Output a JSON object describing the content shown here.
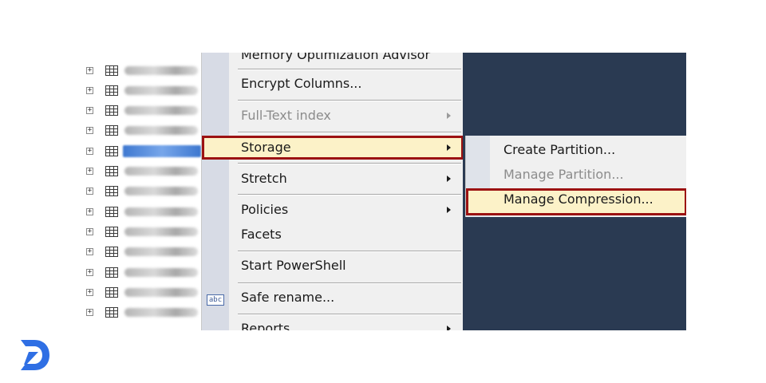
{
  "menu": {
    "items": [
      {
        "label": "Memory Optimization Advisor",
        "enabled": true,
        "submenu": false
      },
      {
        "label": "Encrypt Columns...",
        "enabled": true,
        "submenu": false
      },
      {
        "label": "Full-Text index",
        "enabled": false,
        "submenu": true
      },
      {
        "label": "Storage",
        "enabled": true,
        "submenu": true,
        "highlighted": true
      },
      {
        "label": "Stretch",
        "enabled": true,
        "submenu": true
      },
      {
        "label": "Policies",
        "enabled": true,
        "submenu": true
      },
      {
        "label": "Facets",
        "enabled": true,
        "submenu": false
      },
      {
        "label": "Start PowerShell",
        "enabled": true,
        "submenu": false
      },
      {
        "label": "Safe rename...",
        "enabled": true,
        "submenu": false
      },
      {
        "label": "Reports",
        "enabled": true,
        "submenu": true
      }
    ],
    "rename_icon_text": "abc"
  },
  "submenu": {
    "items": [
      {
        "label": "Create Partition...",
        "enabled": true
      },
      {
        "label": "Manage Partition...",
        "enabled": false
      },
      {
        "label": "Manage Compression...",
        "enabled": true,
        "highlighted": true
      }
    ]
  },
  "tree": {
    "expander_glyph": "+",
    "row_count": 13,
    "selected_row": 4
  },
  "colors": {
    "highlight_border": "#9c1212",
    "highlight_fill": "#fcf2c8",
    "background_dark": "#2a3a52",
    "logo_blue": "#2f6fe4"
  },
  "icons": {
    "tree_expander": "plus-box-icon",
    "tree_table": "table-grid-icon",
    "submenu_arrow": "chevron-right-icon",
    "rename": "rename-abc-icon",
    "logo": "brand-logo-icon"
  }
}
